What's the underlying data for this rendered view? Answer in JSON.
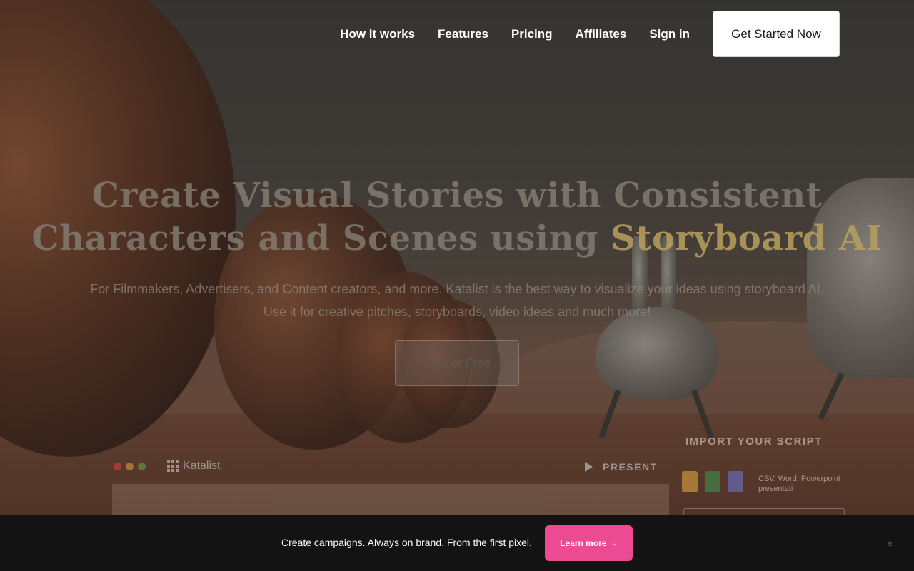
{
  "nav": {
    "links": [
      "How it works",
      "Features",
      "Pricing",
      "Affiliates",
      "Sign in"
    ],
    "cta_label": "Get Started Now"
  },
  "hero": {
    "title_line1": "Create Visual Stories with Consistent",
    "title_line2_prefix": "Characters and Scenes using ",
    "title_accent": "Storyboard AI",
    "subtitle_line1": "For Filmmakers, Advertisers, and Content creators, and more. Katalist is the best way to visualize your ideas using storyboard AI.",
    "subtitle_line2": "Use it for creative pitches, storyboards, video ideas and much more!",
    "try_label": "Try For Free"
  },
  "preview": {
    "logo_text": "Katalist",
    "present_label": "PRESENT",
    "import_title": "IMPORT  YOUR SCRIPT",
    "import_note": "CSV, Word, Powerpoint presentati",
    "window_dot_colors": [
      "#e0443e",
      "#e0a53e",
      "#6aa84f"
    ],
    "file_icon_colors": [
      "#e8b040",
      "#3e9a55",
      "#6a7ad8"
    ]
  },
  "banner": {
    "text": "Create campaigns. Always on brand. From the first pixel.",
    "learn_label": "Learn more →",
    "close_symbol": "×",
    "accent_color": "#ed4a94"
  }
}
